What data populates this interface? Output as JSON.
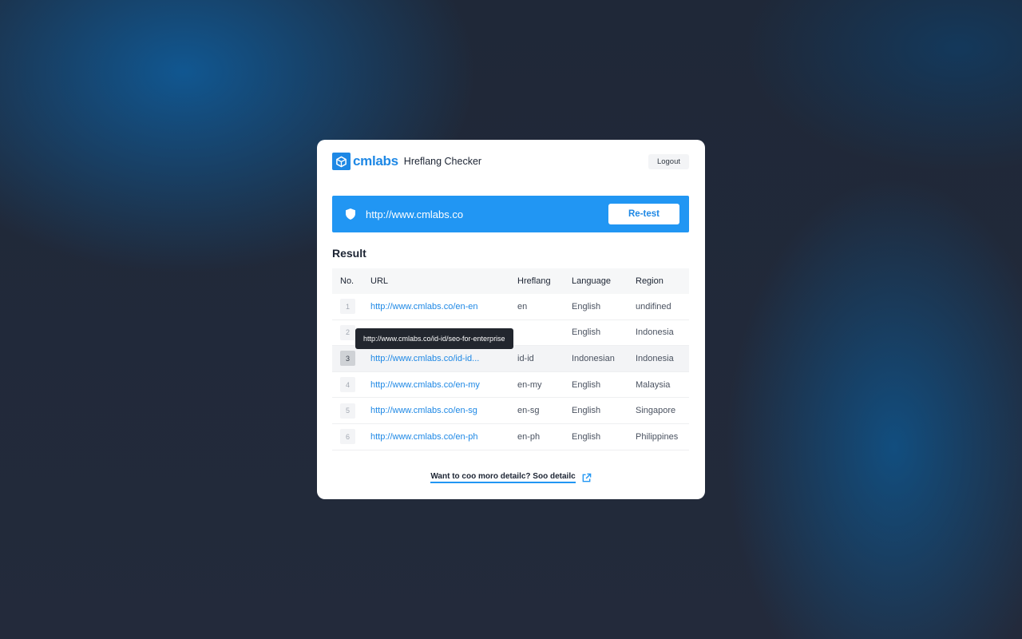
{
  "app": {
    "brand": "cmlabs",
    "name": "Hreflang Checker",
    "logout_label": "Logout"
  },
  "check": {
    "url": "http://www.cmlabs.co",
    "retest_label": "Re-test"
  },
  "result": {
    "title": "Result",
    "columns": [
      "No.",
      "URL",
      "Hreflang",
      "Language",
      "Region"
    ],
    "rows": [
      {
        "no": "1",
        "url": "http://www.cmlabs.co/en-en",
        "hreflang": "en",
        "language": "English",
        "region": "undifined"
      },
      {
        "no": "2",
        "url": "",
        "hreflang": "",
        "language": "English",
        "region": "Indonesia"
      },
      {
        "no": "3",
        "url": "http://www.cmlabs.co/id-id...",
        "hreflang": "id-id",
        "language": "Indonesian",
        "region": "Indonesia"
      },
      {
        "no": "4",
        "url": "http://www.cmlabs.co/en-my",
        "hreflang": "en-my",
        "language": "English",
        "region": "Malaysia"
      },
      {
        "no": "5",
        "url": "http://www.cmlabs.co/en-sg",
        "hreflang": "en-sg",
        "language": "English",
        "region": "Singapore"
      },
      {
        "no": "6",
        "url": "http://www.cmlabs.co/en-ph",
        "hreflang": "en-ph",
        "language": "English",
        "region": "Philippines"
      }
    ],
    "tooltip": "http://www.cmlabs.co/id-id/seo-for-enterprise"
  },
  "footer": {
    "link_label": "Want to coo moro detailc? Soo detailc"
  },
  "colors": {
    "primary": "#2196f3",
    "brand": "#1e88e5",
    "tooltip_bg": "#22262e"
  },
  "icons": {
    "logo": "cube-logo-icon",
    "shield": "shield-icon",
    "external": "external-link-icon"
  }
}
